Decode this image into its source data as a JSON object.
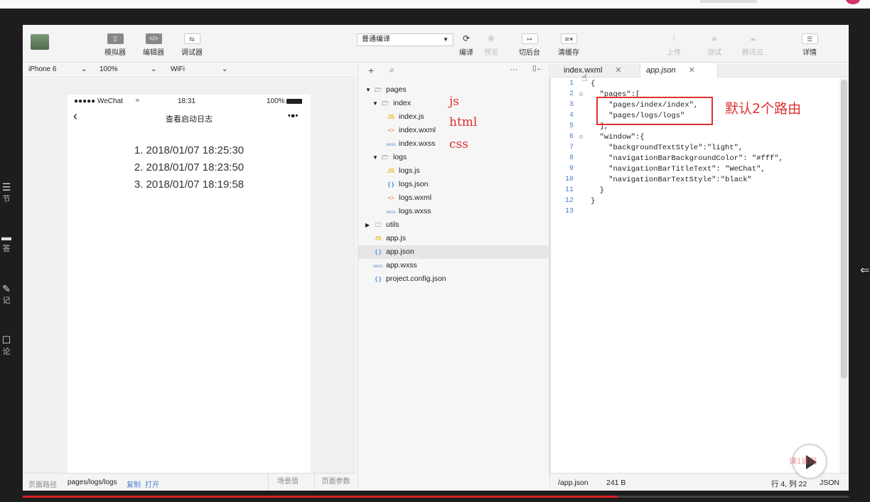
{
  "toolbar": {
    "simulator": "模拟器",
    "editor": "编辑器",
    "debugger": "调试器",
    "compile_mode": "普通编译",
    "compile": "编译",
    "preview": "预览",
    "switch_backend": "切后台",
    "clear_cache": "清缓存",
    "upload": "上传",
    "test": "测试",
    "tencent_cloud": "腾讯云",
    "details": "详情"
  },
  "simbar": {
    "device": "iPhone 6",
    "zoom": "100%",
    "network": "WiFi"
  },
  "phone": {
    "carrier": "●●●●● WeChat",
    "time": "18:31",
    "battery": "100%",
    "nav_title": "查看启动日志",
    "logs": [
      "1. 2018/01/07 18:25:30",
      "2. 2018/01/07 18:23:50",
      "3. 2018/01/07 18:19:58"
    ]
  },
  "simfoot": {
    "path_label": "页面路径",
    "path": "pages/logs/logs",
    "copy": "复制",
    "open": "打开",
    "scene": "场景值",
    "params": "页面参数"
  },
  "filetree": {
    "items": [
      {
        "name": "pages"
      },
      {
        "name": "index"
      },
      {
        "name": "index.js",
        "icon": "JS"
      },
      {
        "name": "index.wxml",
        "icon": "<>"
      },
      {
        "name": "index.wxss",
        "icon": "wxss"
      },
      {
        "name": "logs"
      },
      {
        "name": "logs.js",
        "icon": "JS"
      },
      {
        "name": "logs.json",
        "icon": "{ }"
      },
      {
        "name": "logs.wxml",
        "icon": "<>"
      },
      {
        "name": "logs.wxss",
        "icon": "wxss"
      },
      {
        "name": "utils"
      },
      {
        "name": "app.js",
        "icon": "JS"
      },
      {
        "name": "app.json",
        "icon": "{ }"
      },
      {
        "name": "app.wxss",
        "icon": "wxss"
      },
      {
        "name": "project.config.json",
        "icon": "{ }"
      }
    ]
  },
  "annotations": {
    "js": "js",
    "html": "html",
    "css": "css",
    "routes": "默认2个路由"
  },
  "editor": {
    "tab1": "index.wxml",
    "tab2": "app.json",
    "lines": [
      "{",
      "  \"pages\":[",
      "    \"pages/index/index\",",
      "    \"pages/logs/logs\"",
      "  ],",
      "  \"window\":{",
      "    \"backgroundTextStyle\":\"light\",",
      "    \"navigationBarBackgroundColor\": \"#fff\",",
      "    \"navigationBarTitleText\": \"WeChat\",",
      "    \"navigationBarTextStyle\":\"black\"",
      "  }",
      "}",
      ""
    ],
    "line_numbers": [
      "1",
      "2",
      "3",
      "4",
      "5",
      "6",
      "7",
      "8",
      "9",
      "10",
      "11",
      "12",
      "13"
    ],
    "footer_path": "/app.json",
    "footer_size": "241 B",
    "footer_pos": "行 4, 列 22",
    "footer_lang": "JSON"
  },
  "dock": [
    {
      "label": "节"
    },
    {
      "label": "答"
    },
    {
      "label": "记"
    },
    {
      "label": "论"
    }
  ],
  "video": {
    "progress": 0.72
  },
  "watermark": "课1课网"
}
